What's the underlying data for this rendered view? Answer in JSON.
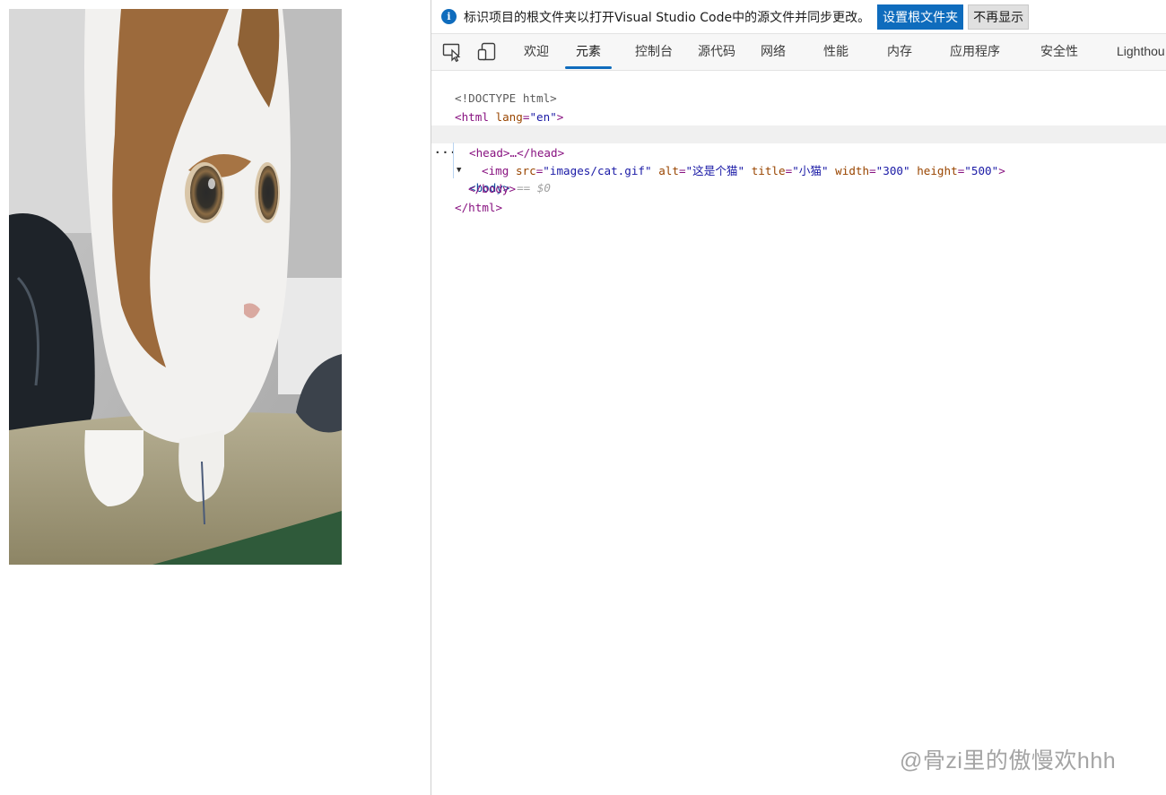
{
  "page": {
    "image_alt": "这是个猫",
    "image_title": "小猫"
  },
  "infobar": {
    "message": "标识项目的根文件夹以打开Visual Studio Code中的源文件并同步更改。",
    "primary_button": "设置根文件夹",
    "secondary_button": "不再显示",
    "icon": "info-icon"
  },
  "toolbar": {
    "icons": [
      "inspect-element-icon",
      "device-emulation-icon"
    ],
    "tabs": [
      "欢迎",
      "元素",
      "控制台",
      "源代码",
      "网络",
      "性能",
      "内存",
      "应用程序",
      "安全性",
      "Lighthou"
    ],
    "active_tab": "元素"
  },
  "dom": {
    "doctype": "<!DOCTYPE html>",
    "html_open": "<html",
    "html_lang_attr": "lang",
    "html_lang_val": "\"en\"",
    "tag_close": ">",
    "head_collapsed": "<head>…</head>",
    "body_open": "<body>",
    "selected_marker": "== $0",
    "dots": "···",
    "img_open": "<img",
    "img_src_attr": "src",
    "img_src_val": "\"images/cat.gif\"",
    "img_alt_attr": "alt",
    "img_alt_val": "\"这是个猫\"",
    "img_title_attr": "title",
    "img_title_val": "\"小猫\"",
    "img_width_attr": "width",
    "img_width_val": "\"300\"",
    "img_height_attr": "height",
    "img_height_val": "\"500\"",
    "body_close": "</body>",
    "html_close": "</html>",
    "eq": "="
  },
  "watermark": "@骨zi里的傲慢欢hhh",
  "colors": {
    "accent": "#0f6cbd",
    "tag": "#881280",
    "attr_name": "#994500",
    "attr_value": "#1a1aa6"
  }
}
